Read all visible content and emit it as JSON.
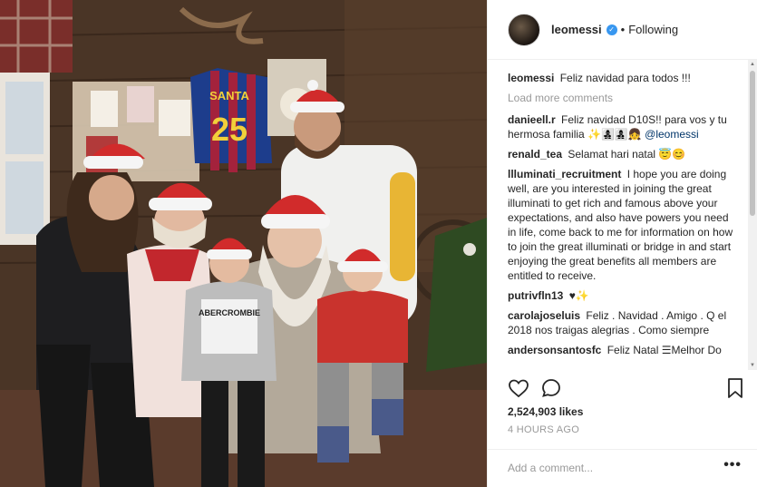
{
  "post": {
    "username": "leomessi",
    "verified": true,
    "follow_label": "Following",
    "separator": "•"
  },
  "photo": {
    "jersey_name": "SANTA",
    "jersey_number": "25",
    "shirt_text": "ABERCROMBIE"
  },
  "caption": {
    "user": "leomessi",
    "text": "Feliz navidad para todos !!!"
  },
  "load_more": "Load more comments",
  "comments": [
    {
      "user": "danieell.r",
      "text": "Feliz navidad D10S!! para vos y tu hermosa familia ✨👩‍👧‍👦👩‍👧‍👦👧 ",
      "mention": "@leomessi"
    },
    {
      "user": "renald_tea",
      "text": "Selamat hari natal 😇😊",
      "mention": ""
    },
    {
      "user": "llluminati_recruitment",
      "text": "I hope you are doing well, are you interested in joining the great illuminati to get rich and famous above your expectations, and also have powers you need in life, come back to me for information on how to join the great illuminati or bridge in and start enjoying the great benefits all members are entitled to receive.",
      "mention": ""
    },
    {
      "user": "putrivfln13",
      "text": "♥✨",
      "mention": ""
    },
    {
      "user": "carolajoseluis",
      "text": "Feliz . Navidad . Amigo . Q el 2018 nos traigas alegrias . Como siempre",
      "mention": ""
    },
    {
      "user": "andersonsantosfc",
      "text": "Feliz Natal ☰Melhor Do",
      "mention": ""
    }
  ],
  "actions": {
    "like_icon": "heart-icon",
    "comment_icon": "comment-icon",
    "save_icon": "bookmark-icon"
  },
  "likes": "2,524,903 likes",
  "time": "4 HOURS AGO",
  "add_comment": {
    "placeholder": "Add a comment...",
    "more_label": "•••"
  },
  "colors": {
    "verified": "#3897f0",
    "mention": "#003569",
    "muted": "#999999",
    "border": "#efefef"
  }
}
